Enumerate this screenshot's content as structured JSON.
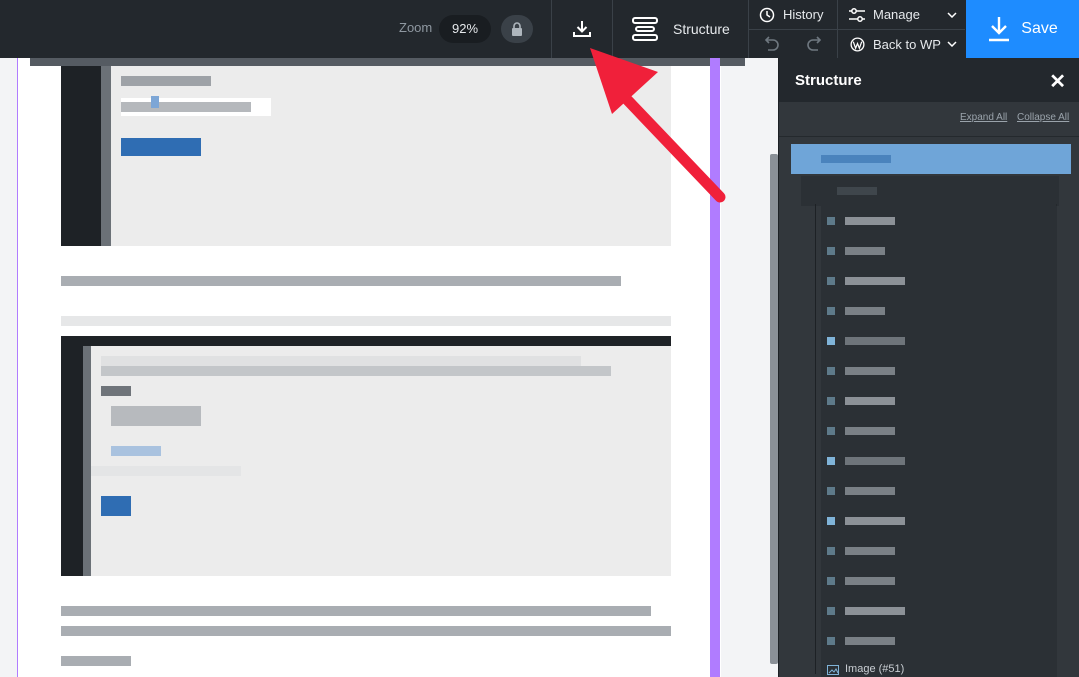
{
  "toolbar": {
    "zoom_label": "Zoom",
    "zoom_value": "92%",
    "structure_label": "Structure",
    "history_label": "History",
    "manage_label": "Manage",
    "back_label": "Back to WP",
    "save_label": "Save",
    "icons": [
      "lock-icon",
      "download-icon",
      "structure-icon",
      "clock-icon",
      "undo-icon",
      "redo-icon",
      "sliders-icon",
      "wordpress-icon",
      "chevron-down-icon",
      "save-download-icon"
    ]
  },
  "sidebar": {
    "title": "Structure",
    "close_glyph": "✕",
    "expand_all": "Expand All",
    "collapse_all": "Collapse All",
    "last_item_label": "Image (#51)"
  },
  "colors": {
    "accent": "#1e8cff",
    "toolbar_bg": "#23282d",
    "sidebar_bg": "#32373c",
    "selected_row": "#6fa5d8",
    "outline": "#b07cff",
    "arrow": "#f0203a"
  }
}
